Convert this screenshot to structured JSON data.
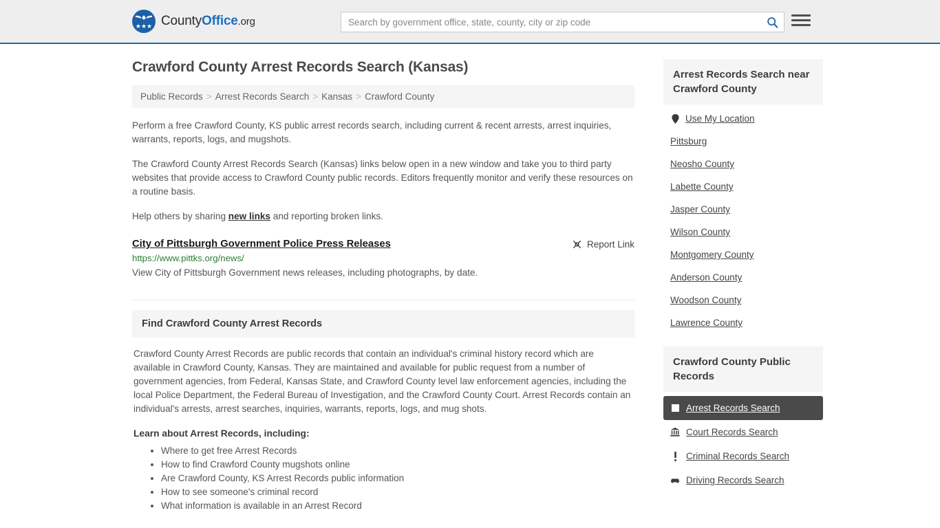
{
  "header": {
    "logo": {
      "part1": "County",
      "part2": "Office",
      "part3": ".org",
      "icon": "eagle-seal-icon",
      "stars": "★★★"
    },
    "search": {
      "placeholder": "Search by government office, state, county, city or zip code",
      "value": "",
      "search_icon": "search-icon"
    },
    "menu_icon": "hamburger-menu-icon",
    "accent_color": "#2a6496",
    "background_color": "#eeeeee"
  },
  "main": {
    "title": "Crawford County Arrest Records Search (Kansas)",
    "breadcrumb": {
      "separator": ">",
      "items": [
        {
          "label": "Public Records"
        },
        {
          "label": "Arrest Records Search"
        },
        {
          "label": "Kansas"
        },
        {
          "label": "Crawford County"
        }
      ]
    },
    "paragraphs": [
      "Perform a free Crawford County, KS public arrest records search, including current & recent arrests, arrest inquiries, warrants, reports, logs, and mugshots.",
      "The Crawford County Arrest Records Search (Kansas) links below open in a new window and take you to third party websites that provide access to Crawford County public records. Editors frequently monitor and verify these resources on a routine basis."
    ],
    "share_line": {
      "before": "Help others by sharing ",
      "link": "new links",
      "after": " and reporting broken links."
    },
    "result": {
      "title": "City of Pittsburgh Government Police Press Releases",
      "url": "https://www.pittks.org/news/",
      "description": "View City of Pittsburgh Government news releases, including photographs, by date.",
      "report_label": "Report Link",
      "report_icon": "broken-link-icon",
      "url_color": "#2e7d32"
    },
    "find_panel": {
      "heading": "Find Crawford County Arrest Records",
      "body": "Crawford County Arrest Records are public records that contain an individual's criminal history record which are available in Crawford County, Kansas. They are maintained and available for public request from a number of government agencies, from Federal, Kansas State, and Crawford County level law enforcement agencies, including the local Police Department, the Federal Bureau of Investigation, and the Crawford County Court. Arrest Records contain an individual's arrests, arrest searches, inquiries, warrants, reports, logs, and mug shots.",
      "learn_heading": "Learn about Arrest Records, including:",
      "learn_items": [
        "Where to get free Arrest Records",
        "How to find Crawford County mugshots online",
        "Are Crawford County, KS Arrest Records public information",
        "How to see someone's criminal record",
        "What information is available in an Arrest Record"
      ]
    }
  },
  "sidebar": {
    "nearby": {
      "heading": "Arrest Records Search near Crawford County",
      "items": [
        {
          "label": "Use My Location",
          "icon": "map-pin-icon"
        },
        {
          "label": "Pittsburg",
          "icon": ""
        },
        {
          "label": "Neosho County",
          "icon": ""
        },
        {
          "label": "Labette County",
          "icon": ""
        },
        {
          "label": "Jasper County",
          "icon": ""
        },
        {
          "label": "Wilson County",
          "icon": ""
        },
        {
          "label": "Montgomery County",
          "icon": ""
        },
        {
          "label": "Anderson County",
          "icon": ""
        },
        {
          "label": "Woodson County",
          "icon": ""
        },
        {
          "label": "Lawrence County",
          "icon": ""
        }
      ]
    },
    "public_records": {
      "heading": "Crawford County Public Records",
      "active_color": "#4a4a4a",
      "items": [
        {
          "label": "Arrest Records Search",
          "icon": "white-square-icon",
          "active": true
        },
        {
          "label": "Court Records Search",
          "icon": "courthouse-icon",
          "active": false
        },
        {
          "label": "Criminal Records Search",
          "icon": "exclamation-icon",
          "active": false
        },
        {
          "label": "Driving Records Search",
          "icon": "car-icon",
          "active": false
        }
      ]
    }
  }
}
